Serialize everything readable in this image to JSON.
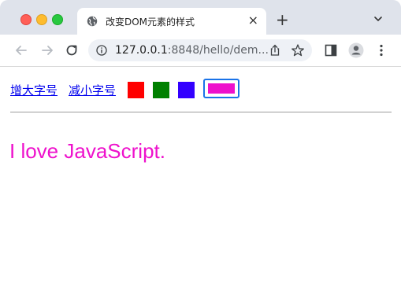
{
  "window": {
    "tab_title": "改变DOM元素的样式",
    "tab_close": "×",
    "new_tab": "+"
  },
  "toolbar": {
    "url_host": "127.0.0.1",
    "url_path": ":8848/hello/dem..."
  },
  "page": {
    "increase_font_label": "增大字号",
    "decrease_font_label": "减小字号",
    "swatches": [
      {
        "name": "red",
        "color": "#ff0000"
      },
      {
        "name": "green",
        "color": "#008000"
      },
      {
        "name": "blue",
        "color": "#3300ff"
      },
      {
        "name": "magenta",
        "color": "#ee11cc"
      }
    ],
    "selected_swatch": "magenta",
    "demo_text": "I love JavaScript.",
    "demo_text_color": "#ee11cc"
  }
}
